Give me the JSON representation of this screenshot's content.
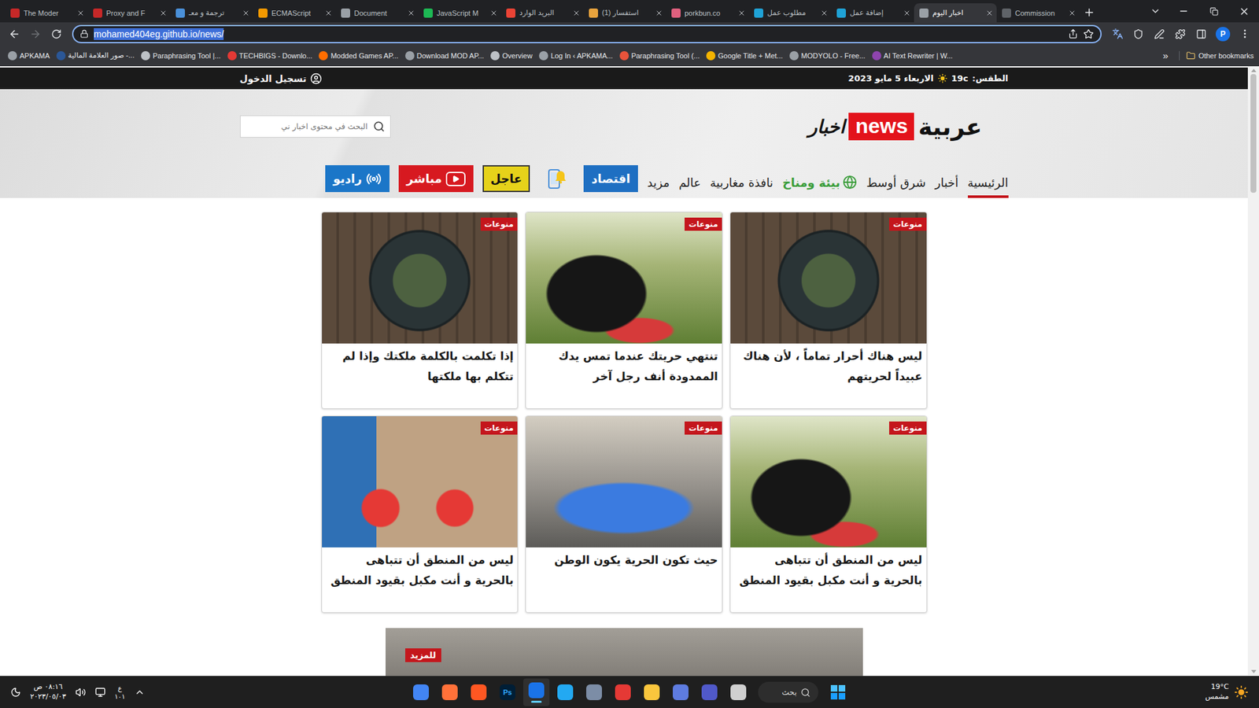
{
  "browser": {
    "tabs": [
      {
        "title": "The Moder",
        "selected": false,
        "color": "#c62828"
      },
      {
        "title": "Proxy and F",
        "selected": false,
        "color": "#c62828"
      },
      {
        "title": "ترجمة و معـ",
        "selected": false,
        "color": "#4a90d9"
      },
      {
        "title": "ECMAScript",
        "selected": false,
        "color": "#f29900"
      },
      {
        "title": "Document",
        "selected": false,
        "color": "#9aa0a6"
      },
      {
        "title": "JavaScript M",
        "selected": false,
        "color": "#1db954"
      },
      {
        "title": "البريد الوارد",
        "selected": false,
        "color": "#ea4335"
      },
      {
        "title": "(1) استفسار",
        "selected": false,
        "color": "#e8a33d"
      },
      {
        "title": "porkbun.co",
        "selected": false,
        "color": "#e0607e"
      },
      {
        "title": "مطلوب عمل",
        "selected": false,
        "color": "#1fa2d6"
      },
      {
        "title": "إضافة عمل",
        "selected": false,
        "color": "#1fa2d6"
      },
      {
        "title": "اخبار اليوم",
        "selected": true,
        "color": "#9aa0a6"
      },
      {
        "title": "Commission",
        "selected": false,
        "color": "#5f6368"
      }
    ],
    "navigation": {
      "back_enabled": true,
      "forward_enabled": false
    },
    "address": {
      "url": "mohamed404eg.github.io/news/",
      "selected": true
    },
    "profile": "P",
    "bookmarks": [
      {
        "label": "APKAMA",
        "color": "#9aa0a6"
      },
      {
        "label": "صور العلامة المالية -...",
        "color": "#2b5797"
      },
      {
        "label": "Paraphrasing Tool |...",
        "color": "#bdc1c6"
      },
      {
        "label": "TECHBIGS - Downlo...",
        "color": "#e53935"
      },
      {
        "label": "Modded Games AP...",
        "color": "#ff6d00"
      },
      {
        "label": "Download MOD AP...",
        "color": "#9aa0a6"
      },
      {
        "label": "Overview",
        "color": "#bdc1c6"
      },
      {
        "label": "Log In ‹ APKAMA...",
        "color": "#9aa0a6"
      },
      {
        "label": "Paraphrasing Tool (...",
        "color": "#e8533b"
      },
      {
        "label": "Google Title + Met...",
        "color": "#f4b400"
      },
      {
        "label": "MODYOLO - Free...",
        "color": "#9aa0a6"
      },
      {
        "label": "AI Text Rewriter | W...",
        "color": "#8e44ad"
      }
    ],
    "bookmarks_overflow": "»",
    "other_bookmarks": "Other bookmarks"
  },
  "site": {
    "topbar": {
      "weather_label": "الطقس:",
      "temperature": "19c",
      "date": "الاربعاء 5 مايو 2023",
      "login": "تسجيل الدخول"
    },
    "logo": {
      "word": "عربية",
      "badge": "news",
      "script": "اخبار"
    },
    "search": {
      "placeholder": "البحث في محتوى اخبار ني"
    },
    "nav": [
      {
        "label": "الرئيسية",
        "selected": true,
        "kind": "link"
      },
      {
        "label": "أخبار",
        "selected": false,
        "kind": "link"
      },
      {
        "label": "شرق أوسط",
        "selected": false,
        "kind": "link"
      },
      {
        "label": "بيئة ومناخ",
        "selected": false,
        "kind": "brand"
      },
      {
        "label": "نافذة مغاربية",
        "selected": false,
        "kind": "link"
      },
      {
        "label": "عالم",
        "selected": false,
        "kind": "link"
      },
      {
        "label": "مزيد",
        "selected": false,
        "kind": "link"
      }
    ],
    "nav_buttons": [
      {
        "label": "اقتصاد",
        "kind": "economy"
      },
      {
        "kind": "alerts"
      },
      {
        "label": "عاجل",
        "kind": "urgent"
      },
      {
        "label": "مباشر",
        "kind": "live"
      },
      {
        "label": "راديو",
        "kind": "radio"
      }
    ],
    "cards": [
      {
        "category": "منوعات",
        "title": "ليس هناك أحرار تماماً ، لأن هناك عبيداً لحريتهم",
        "kind": "food"
      },
      {
        "category": "منوعات",
        "title": "تنتهي حريتك عندما تمس يدك الممدودة أنف رجل آخر",
        "kind": "guitar"
      },
      {
        "category": "منوعات",
        "title": "إذا تكلمت بالكلمة ملكتك وإذا لم تتكلم بها ملكتها",
        "kind": "food"
      },
      {
        "category": "منوعات",
        "title": "ليس من المنطق أن تتباهى بالحرية و أنت مكبل بقيود المنطق",
        "kind": "guitar"
      },
      {
        "category": "منوعات",
        "title": "حيث تكون الحرية يكون الوطن",
        "kind": "car"
      },
      {
        "category": "منوعات",
        "title": "ليس من المنطق أن تتباهى بالحرية و أنت مكبل بقيود المنطق",
        "kind": "bicycle"
      }
    ],
    "banner": {
      "badge": "للمزيد"
    },
    "scrollbar": {
      "level": 0.2
    }
  },
  "taskbar": {
    "clock": {
      "time": "٠٨:١٦ ص",
      "date": "٢٠٢٣/٠٥/٠٣"
    },
    "language": {
      "primary": "ع",
      "secondary": "١٠١"
    },
    "apps": [
      {
        "color": "#4285f4",
        "selected": false
      },
      {
        "color": "#ff7139",
        "selected": false
      },
      {
        "color": "#ff5722",
        "selected": false
      },
      {
        "color": "#001e36",
        "selected": false,
        "label": "Ps"
      },
      {
        "color": "#1a73e8",
        "selected": true
      },
      {
        "color": "#23a9f2",
        "selected": false
      },
      {
        "color": "#7c8da6",
        "selected": false
      },
      {
        "color": "#e53935",
        "selected": false
      },
      {
        "color": "#f9c63d",
        "selected": false
      },
      {
        "color": "#5e7ce0",
        "selected": false
      },
      {
        "color": "#5059c9",
        "selected": false
      },
      {
        "color": "#d0d0d0",
        "selected": false
      }
    ],
    "search": {
      "label": "بحث"
    },
    "weather": {
      "temperature": "19°C",
      "condition": "مشمس"
    }
  }
}
